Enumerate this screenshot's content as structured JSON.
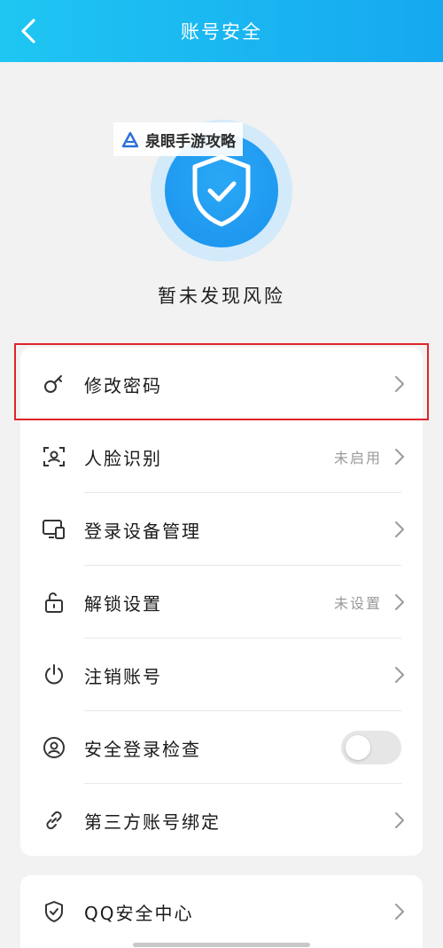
{
  "header": {
    "title": "账号安全",
    "back_icon": "chevron-left-icon",
    "colors": {
      "start": "#1fc6f2",
      "end": "#16a8f0"
    }
  },
  "security_status": {
    "icon": "shield-check-icon",
    "text": "暂未发现风险",
    "color": "#1a92ee"
  },
  "watermark": {
    "text": "泉眼手游攻略",
    "icon": "logo-triangle-icon"
  },
  "settings": [
    {
      "label": "修改密码",
      "icon": "key-icon",
      "value": "",
      "control": "arrow",
      "highlighted": true
    },
    {
      "label": "人脸识别",
      "icon": "face-scan-icon",
      "value": "未启用",
      "control": "arrow"
    },
    {
      "label": "登录设备管理",
      "icon": "devices-icon",
      "value": "",
      "control": "arrow"
    },
    {
      "label": "解锁设置",
      "icon": "unlock-icon",
      "value": "未设置",
      "control": "arrow"
    },
    {
      "label": "注销账号",
      "icon": "power-icon",
      "value": "",
      "control": "arrow"
    },
    {
      "label": "安全登录检查",
      "icon": "user-circle-icon",
      "value": "",
      "control": "toggle",
      "toggle_on": false
    },
    {
      "label": "第三方账号绑定",
      "icon": "link-icon",
      "value": "",
      "control": "arrow"
    }
  ],
  "bottom": {
    "label": "QQ安全中心",
    "icon": "shield-check-outline-icon"
  },
  "highlight_color": "#e0232a"
}
